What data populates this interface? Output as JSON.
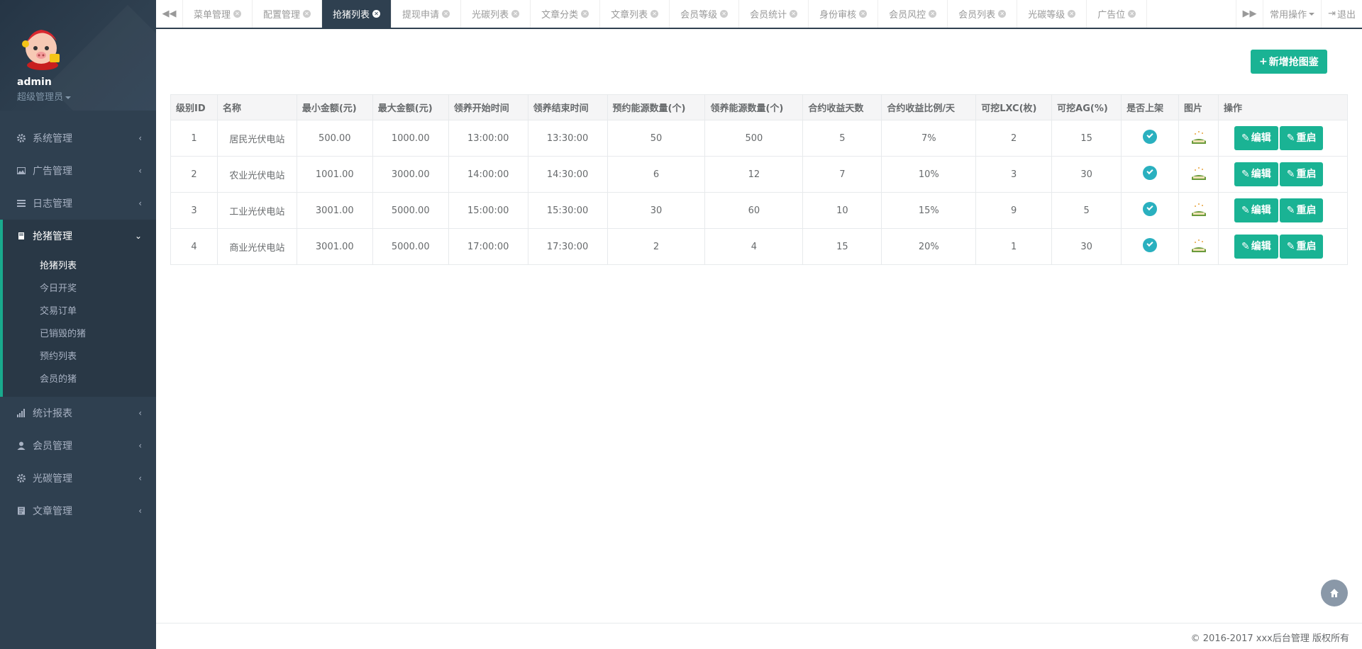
{
  "sidebar": {
    "user": {
      "name": "admin",
      "role": "超级管理员"
    },
    "menu": [
      {
        "label": "系统管理",
        "icon": "gear-icon"
      },
      {
        "label": "广告管理",
        "icon": "image-icon"
      },
      {
        "label": "日志管理",
        "icon": "list-icon"
      },
      {
        "label": "抢猪管理",
        "icon": "book-icon",
        "active": true
      },
      {
        "label": "统计报表",
        "icon": "bar-chart-icon"
      },
      {
        "label": "会员管理",
        "icon": "user-icon"
      },
      {
        "label": "光碳管理",
        "icon": "gear-icon"
      },
      {
        "label": "文章管理",
        "icon": "document-icon"
      }
    ],
    "submenu": [
      "抢猪列表",
      "今日开奖",
      "交易订单",
      "已销毁的猪",
      "预约列表",
      "会员的猪"
    ]
  },
  "tabs": [
    {
      "label": "菜单管理"
    },
    {
      "label": "配置管理"
    },
    {
      "label": "抢猪列表",
      "active": true
    },
    {
      "label": "提现申请"
    },
    {
      "label": "光碳列表"
    },
    {
      "label": "文章分类"
    },
    {
      "label": "文章列表"
    },
    {
      "label": "会员等级"
    },
    {
      "label": "会员统计"
    },
    {
      "label": "身份审核"
    },
    {
      "label": "会员风控"
    },
    {
      "label": "会员列表"
    },
    {
      "label": "光碳等级"
    },
    {
      "label": "广告位"
    }
  ],
  "tabbar_right": {
    "common_ops": "常用操作",
    "logout": "退出"
  },
  "toolbar": {
    "add_label": "新增抢图鉴"
  },
  "table": {
    "headers": [
      "级别ID",
      "名称",
      "最小金额(元)",
      "最大金额(元)",
      "领养开始时间",
      "领养结束时间",
      "预约能源数量(个)",
      "领养能源数量(个)",
      "合约收益天数",
      "合约收益比例/天",
      "可挖LXC(枚)",
      "可挖AG(%)",
      "是否上架",
      "图片",
      "操作"
    ],
    "rows": [
      [
        "1",
        "居民光伏电站",
        "500.00",
        "1000.00",
        "13:00:00",
        "13:30:00",
        "50",
        "500",
        "5",
        "7%",
        "2",
        "15"
      ],
      [
        "2",
        "农业光伏电站",
        "1001.00",
        "3000.00",
        "14:00:00",
        "14:30:00",
        "6",
        "12",
        "7",
        "10%",
        "3",
        "30"
      ],
      [
        "3",
        "工业光伏电站",
        "3001.00",
        "5000.00",
        "15:00:00",
        "15:30:00",
        "30",
        "60",
        "10",
        "15%",
        "9",
        "5"
      ],
      [
        "4",
        "商业光伏电站",
        "3001.00",
        "5000.00",
        "17:00:00",
        "17:30:00",
        "2",
        "4",
        "15",
        "20%",
        "1",
        "30"
      ]
    ],
    "edit_label": "编辑",
    "restart_label": "重启"
  },
  "footer": {
    "copyright": "© 2016-2017 xxx后台管理 版权所有"
  },
  "colors": {
    "sidebar_bg": "#2f4050",
    "accent": "#1ab394",
    "active_tab": "#2f4050"
  }
}
